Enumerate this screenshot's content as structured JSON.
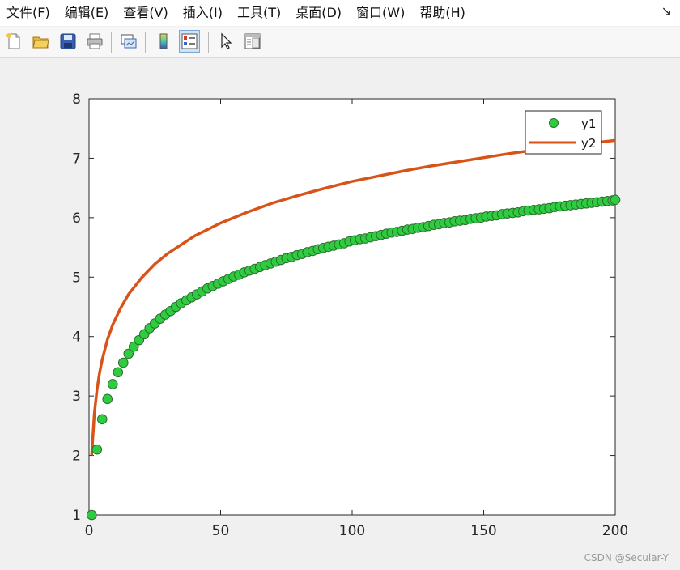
{
  "menubar": {
    "items": [
      {
        "label": "文件(F)"
      },
      {
        "label": "编辑(E)"
      },
      {
        "label": "查看(V)"
      },
      {
        "label": "插入(I)"
      },
      {
        "label": "工具(T)"
      },
      {
        "label": "桌面(D)"
      },
      {
        "label": "窗口(W)"
      },
      {
        "label": "帮助(H)"
      }
    ],
    "dock_arrow": "↘"
  },
  "toolbar": {
    "icons": [
      "new-figure-icon",
      "open-file-icon",
      "save-icon",
      "print-icon",
      "link-plot-icon",
      "colorbar-icon",
      "legend-icon",
      "pointer-icon",
      "property-inspector-icon"
    ],
    "pressed": "legend-icon"
  },
  "chart_data": {
    "type": "line",
    "xlim": [
      0,
      200
    ],
    "ylim": [
      1,
      8
    ],
    "xticks": [
      0,
      50,
      100,
      150,
      200
    ],
    "yticks": [
      1,
      2,
      3,
      4,
      5,
      6,
      7,
      8
    ],
    "grid": false,
    "legend_placement": "top-right",
    "series": [
      {
        "name": "y1",
        "style": "markers",
        "marker_color": "#2ecc40",
        "marker_edge": "#2e6b2e",
        "x": [
          1,
          3,
          5,
          7,
          9,
          11,
          13,
          15,
          17,
          19,
          21,
          23,
          25,
          27,
          29,
          31,
          33,
          35,
          37,
          39,
          41,
          43,
          45,
          47,
          49,
          51,
          53,
          55,
          57,
          59,
          61,
          63,
          65,
          67,
          69,
          71,
          73,
          75,
          77,
          79,
          81,
          83,
          85,
          87,
          89,
          91,
          93,
          95,
          97,
          99,
          101,
          103,
          105,
          107,
          109,
          111,
          113,
          115,
          117,
          119,
          121,
          123,
          125,
          127,
          129,
          131,
          133,
          135,
          137,
          139,
          141,
          143,
          145,
          147,
          149,
          151,
          153,
          155,
          157,
          159,
          161,
          163,
          165,
          167,
          169,
          171,
          173,
          175,
          177,
          179,
          181,
          183,
          185,
          187,
          189,
          191,
          193,
          195,
          197,
          199,
          200
        ],
        "y": [
          1.0,
          2.1,
          2.61,
          2.95,
          3.2,
          3.4,
          3.56,
          3.71,
          3.83,
          3.94,
          4.04,
          4.14,
          4.22,
          4.3,
          4.37,
          4.43,
          4.5,
          4.56,
          4.61,
          4.66,
          4.71,
          4.76,
          4.81,
          4.85,
          4.89,
          4.93,
          4.97,
          5.01,
          5.04,
          5.08,
          5.11,
          5.14,
          5.17,
          5.2,
          5.23,
          5.26,
          5.29,
          5.32,
          5.34,
          5.37,
          5.39,
          5.42,
          5.44,
          5.47,
          5.49,
          5.51,
          5.53,
          5.55,
          5.57,
          5.6,
          5.62,
          5.64,
          5.65,
          5.67,
          5.69,
          5.71,
          5.73,
          5.75,
          5.76,
          5.78,
          5.8,
          5.81,
          5.83,
          5.84,
          5.86,
          5.88,
          5.89,
          5.91,
          5.92,
          5.94,
          5.95,
          5.96,
          5.98,
          5.99,
          6.0,
          6.02,
          6.03,
          6.04,
          6.06,
          6.07,
          6.08,
          6.09,
          6.11,
          6.12,
          6.13,
          6.14,
          6.15,
          6.16,
          6.18,
          6.19,
          6.2,
          6.21,
          6.22,
          6.23,
          6.24,
          6.25,
          6.26,
          6.27,
          6.28,
          6.29,
          6.3
        ]
      },
      {
        "name": "y2",
        "style": "line",
        "color": "#d95319",
        "x": [
          1,
          2,
          3,
          4,
          5,
          7,
          9,
          12,
          15,
          20,
          25,
          30,
          40,
          50,
          60,
          70,
          80,
          90,
          100,
          110,
          120,
          130,
          140,
          150,
          160,
          170,
          180,
          190,
          200
        ],
        "y": [
          2.0,
          2.69,
          3.1,
          3.39,
          3.61,
          3.95,
          4.2,
          4.48,
          4.71,
          4.99,
          5.22,
          5.4,
          5.69,
          5.91,
          6.09,
          6.25,
          6.38,
          6.5,
          6.61,
          6.7,
          6.79,
          6.87,
          6.94,
          7.01,
          7.08,
          7.14,
          7.19,
          7.25,
          7.3
        ]
      }
    ]
  },
  "watermark": "CSDN @Secular-Y"
}
